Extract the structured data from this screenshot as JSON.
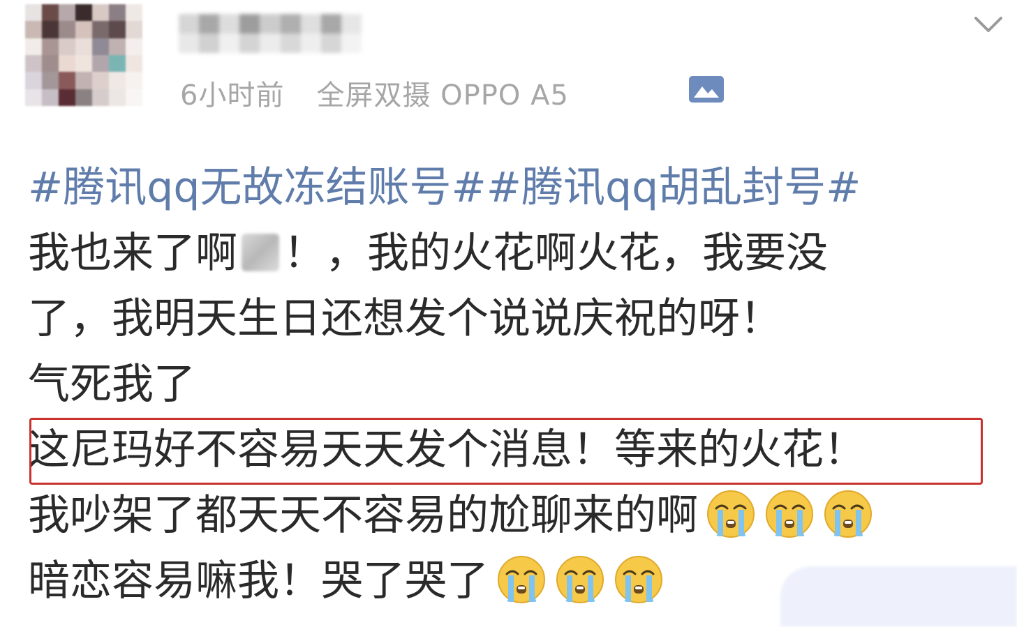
{
  "header": {
    "timestamp": "6小时前",
    "device": "全屏双摄 OPPO A5",
    "expand_icon": "chevron-down-icon",
    "album_icon": "image-album-icon"
  },
  "post": {
    "hashtag_1": "#腾讯qq无故冻结账号#",
    "hashtag_2": "#腾讯qq胡乱封号#",
    "line2_a": "我也来了啊",
    "line2_b": "！，我的火花啊火花，我要没",
    "line3": "了，我明天生日还想发个说说庆祝的呀！",
    "line4": "气死我了",
    "line5_highlighted": "这尼玛好不容易天天发个消息！等来的火花！",
    "line6": "我吵架了都天天不容易的尬聊来的啊",
    "line7": "暗恋容易嘛我！哭了哭了",
    "emoji_name": "crying-face-emoji"
  },
  "colors": {
    "hashtag": "#5f7cab",
    "meta_text": "#a6a6a6",
    "highlight_border": "#c8322e",
    "body_text": "#2a2a2a"
  }
}
